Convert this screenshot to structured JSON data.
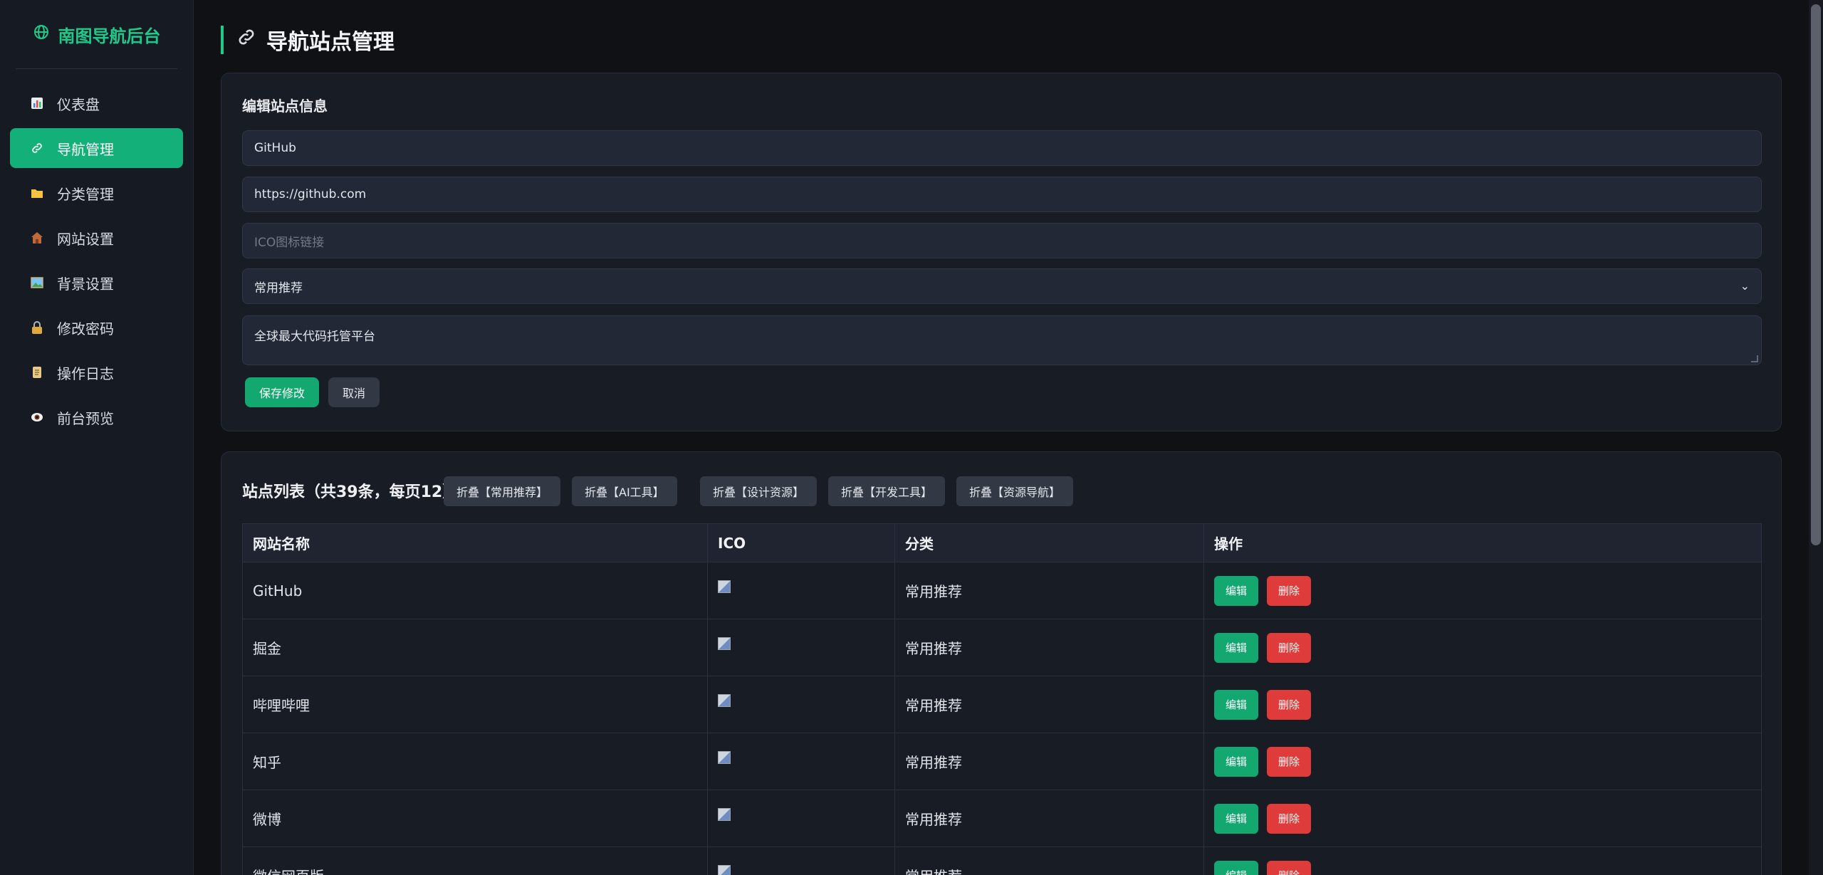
{
  "sidebar": {
    "brand": "南图导航后台",
    "items": [
      {
        "label": "仪表盘",
        "icon": "bar-chart-icon"
      },
      {
        "label": "导航管理",
        "icon": "link-icon",
        "active": true
      },
      {
        "label": "分类管理",
        "icon": "folder-icon"
      },
      {
        "label": "网站设置",
        "icon": "house-icon"
      },
      {
        "label": "背景设置",
        "icon": "picture-icon"
      },
      {
        "label": "修改密码",
        "icon": "lock-icon"
      },
      {
        "label": "操作日志",
        "icon": "scroll-icon"
      },
      {
        "label": "前台预览",
        "icon": "eye-icon"
      }
    ]
  },
  "page": {
    "title": "导航站点管理"
  },
  "edit_form": {
    "title": "编辑站点信息",
    "name_value": "GitHub",
    "url_value": "https://github.com",
    "ico_placeholder": "ICO图标链接",
    "category_value": "常用推荐",
    "description_value": "全球最大代码托管平台",
    "save_label": "保存修改",
    "cancel_label": "取消"
  },
  "site_list": {
    "title": "站点列表（共39条，每页12）",
    "fold_buttons": [
      "折叠【常用推荐】",
      "折叠【AI工具】",
      "折叠【设计资源】",
      "折叠【开发工具】",
      "折叠【资源导航】"
    ],
    "columns": [
      "网站名称",
      "ICO",
      "分类",
      "操作"
    ],
    "edit_label": "编辑",
    "delete_label": "删除",
    "rows": [
      {
        "name": "GitHub",
        "category": "常用推荐"
      },
      {
        "name": "掘金",
        "category": "常用推荐"
      },
      {
        "name": "哔哩哔哩",
        "category": "常用推荐"
      },
      {
        "name": "知乎",
        "category": "常用推荐"
      },
      {
        "name": "微博",
        "category": "常用推荐"
      },
      {
        "name": "微信网页版",
        "category": "常用推荐"
      }
    ]
  },
  "colors": {
    "accent": "#1ec98a",
    "primary_button": "#12a870",
    "danger_button": "#e03b3b",
    "background": "#0f1115",
    "card": "#181c25"
  }
}
